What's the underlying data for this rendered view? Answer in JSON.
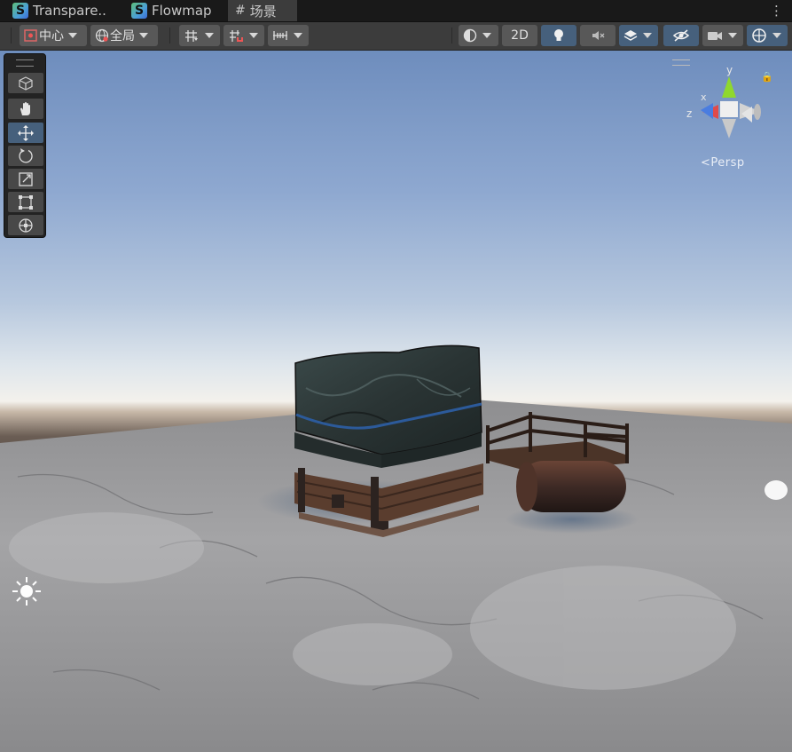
{
  "tabs": [
    {
      "label": "Transpare..",
      "icon": "shader-icon"
    },
    {
      "label": "Flowmap",
      "icon": "shader-icon"
    },
    {
      "label": "场景",
      "icon": "scene-hash-icon"
    }
  ],
  "tab_menu_glyph": "⋮",
  "toolbar": {
    "pivot_label": "中心",
    "space_label": "全局",
    "mode_2d_label": "2D"
  },
  "tools": [
    "view-tool",
    "hand-tool",
    "move-tool",
    "rotate-tool",
    "scale-tool",
    "rect-tool",
    "transform-tool"
  ],
  "active_tool": "move-tool",
  "gizmo": {
    "y_label": "y",
    "x_label": "x",
    "z_label": "z",
    "projection_label": "Persp"
  },
  "colors": {
    "selected_tool": "#46607c",
    "axis_x": "#e04b4b",
    "axis_y": "#8fd82e",
    "axis_z": "#4a7de0"
  }
}
